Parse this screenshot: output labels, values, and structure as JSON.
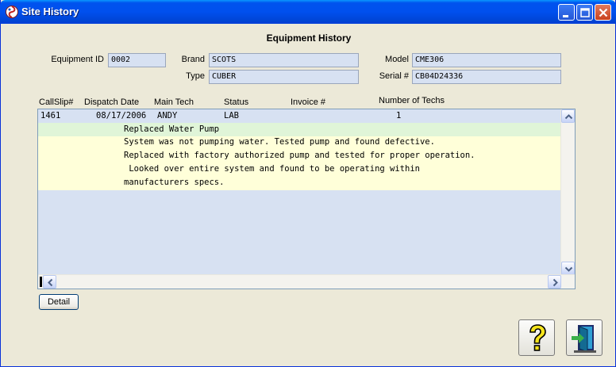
{
  "window": {
    "title": "Site History",
    "controls": [
      "minimize-icon",
      "maximize-icon",
      "close-icon"
    ]
  },
  "header": {
    "title": "Equipment History"
  },
  "equipment": {
    "id_label": "Equipment ID",
    "id_value": "0002",
    "brand_label": "Brand",
    "brand_value": "SCOTS",
    "type_label": "Type",
    "type_value": "CUBER",
    "model_label": "Model",
    "model_value": "CME306",
    "serial_label": "Serial #",
    "serial_value": "CB04D24336"
  },
  "columns": [
    "CallSlip#",
    "Dispatch Date",
    "Main Tech",
    "Status",
    "Invoice #",
    "Number of Techs"
  ],
  "records": [
    {
      "callslip": "1461",
      "dispatch_date": "08/17/2006",
      "main_tech": "ANDY",
      "status": "LAB",
      "invoice": "",
      "num_techs": "1",
      "summary": "Replaced Water Pump",
      "description": [
        "System was not pumping water. Tested pump and found defective.",
        "Replaced with factory authorized pump and tested for proper operation.",
        " Looked over entire system and found to be operating within",
        "manufacturers specs."
      ]
    }
  ],
  "buttons": {
    "detail": "Detail",
    "help_icon": "help-question-icon",
    "exit_icon": "exit-door-icon"
  },
  "colors": {
    "titlebar": "#0053ee",
    "field_bg": "#d7e1f2",
    "summary_row": "#e0f5d8",
    "description_row": "#ffffd9",
    "window_bg": "#ece9d8"
  }
}
